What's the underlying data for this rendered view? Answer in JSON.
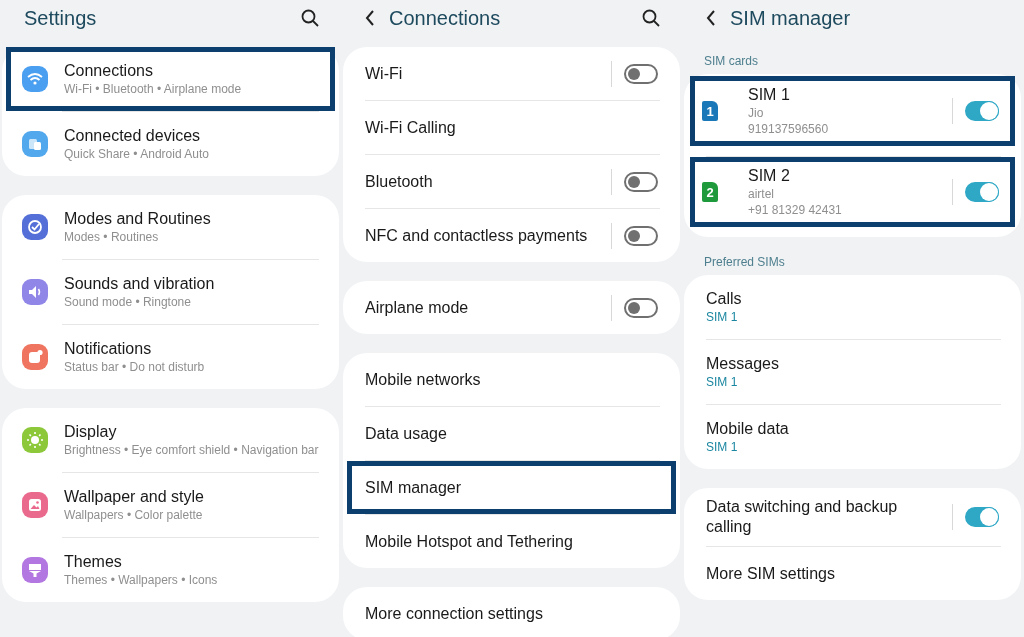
{
  "panels": [
    {
      "title": "Settings",
      "back": false,
      "search": true,
      "groups": [
        {
          "items": [
            {
              "kind": "icon",
              "title": "Connections",
              "subtitle": "Wi-Fi • Bluetooth • Airplane mode",
              "color": "#4a9ff0",
              "highlighted": true
            },
            {
              "kind": "icon",
              "title": "Connected devices",
              "subtitle": "Quick Share • Android Auto",
              "color": "#52a8ec",
              "highlighted": false
            }
          ]
        },
        {
          "items": [
            {
              "kind": "icon",
              "title": "Modes and Routines",
              "subtitle": "Modes • Routines",
              "color": "#5470d8",
              "highlighted": false
            },
            {
              "kind": "icon",
              "title": "Sounds and vibration",
              "subtitle": "Sound mode • Ringtone",
              "color": "#8f86e8",
              "highlighted": false
            },
            {
              "kind": "icon",
              "title": "Notifications",
              "subtitle": "Status bar • Do not disturb",
              "color": "#ef7560",
              "highlighted": false
            }
          ]
        },
        {
          "items": [
            {
              "kind": "icon",
              "title": "Display",
              "subtitle": "Brightness • Eye comfort shield • Navigation bar",
              "color": "#8cc83a",
              "highlighted": false
            },
            {
              "kind": "icon",
              "title": "Wallpaper and style",
              "subtitle": "Wallpapers • Color palette",
              "color": "#ea6a8e",
              "highlighted": false
            },
            {
              "kind": "icon",
              "title": "Themes",
              "subtitle": "Themes • Wallpapers • Icons",
              "color": "#b277e0",
              "highlighted": false
            }
          ]
        }
      ]
    },
    {
      "title": "Connections",
      "back": true,
      "search": true,
      "groups": [
        {
          "items": [
            {
              "kind": "toggle",
              "title": "Wi-Fi",
              "on": false,
              "highlighted": false
            },
            {
              "kind": "nav",
              "title": "Wi-Fi Calling",
              "highlighted": false
            },
            {
              "kind": "toggle",
              "title": "Bluetooth",
              "on": false,
              "highlighted": false
            },
            {
              "kind": "toggle",
              "title": "NFC and contactless payments",
              "on": false,
              "highlighted": false
            }
          ]
        },
        {
          "items": [
            {
              "kind": "toggle",
              "title": "Airplane mode",
              "on": false,
              "highlighted": false
            }
          ]
        },
        {
          "items": [
            {
              "kind": "nav",
              "title": "Mobile networks",
              "highlighted": false
            },
            {
              "kind": "nav",
              "title": "Data usage",
              "highlighted": false
            },
            {
              "kind": "nav",
              "title": "SIM manager",
              "highlighted": true
            },
            {
              "kind": "nav",
              "title": "Mobile Hotspot and Tethering",
              "highlighted": false
            }
          ]
        },
        {
          "items": [
            {
              "kind": "nav",
              "title": "More connection settings",
              "highlighted": false
            }
          ]
        }
      ]
    },
    {
      "title": "SIM manager",
      "back": true,
      "search": false,
      "groups": [
        {
          "label": "SIM cards",
          "items": [
            {
              "kind": "sim",
              "title": "SIM 1",
              "badge": "1",
              "color": "#1a78b8",
              "lines": [
                "Jio",
                "919137596560"
              ],
              "on": true,
              "highlighted": true
            },
            {
              "kind": "sim",
              "title": "SIM 2",
              "badge": "2",
              "color": "#1e9a3c",
              "lines": [
                "airtel",
                "+91 81329 42431"
              ],
              "on": true,
              "highlighted": true
            }
          ]
        },
        {
          "label": "Preferred SIMs",
          "items": [
            {
              "kind": "value",
              "title": "Calls",
              "value": "SIM 1",
              "highlighted": false
            },
            {
              "kind": "value",
              "title": "Messages",
              "value": "SIM 1",
              "highlighted": false
            },
            {
              "kind": "value",
              "title": "Mobile data",
              "value": "SIM 1",
              "highlighted": false
            }
          ]
        },
        {
          "items": [
            {
              "kind": "toggle",
              "title": "Data switching and backup calling",
              "on": true,
              "highlighted": false
            },
            {
              "kind": "nav",
              "title": "More SIM settings",
              "highlighted": false
            }
          ]
        }
      ]
    }
  ]
}
